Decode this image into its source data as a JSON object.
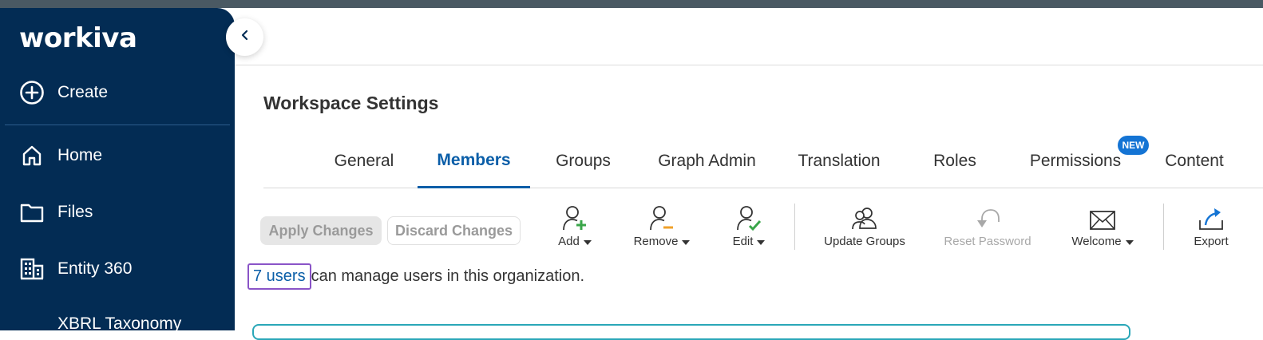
{
  "sidebar": {
    "logo": "workiva",
    "create": {
      "label": "Create",
      "icon": "plus-circle-icon"
    },
    "items": [
      {
        "label": "Home",
        "icon": "home-icon"
      },
      {
        "label": "Files",
        "icon": "folder-icon"
      },
      {
        "label": "Entity 360",
        "icon": "building-icon"
      },
      {
        "label": "XBRL Taxonomy",
        "icon": "taxonomy-icon"
      }
    ]
  },
  "page": {
    "title": "Workspace Settings"
  },
  "tabs": [
    {
      "label": "General"
    },
    {
      "label": "Members",
      "active": true
    },
    {
      "label": "Groups"
    },
    {
      "label": "Graph Admin"
    },
    {
      "label": "Translation"
    },
    {
      "label": "Roles"
    },
    {
      "label": "Permissions",
      "badge": "NEW"
    },
    {
      "label": "Content"
    }
  ],
  "actions": {
    "apply": "Apply Changes",
    "discard": "Discard Changes"
  },
  "toolbar": [
    {
      "label": "Add",
      "icon": "add-user-icon",
      "dropdown": true
    },
    {
      "label": "Remove",
      "icon": "remove-user-icon",
      "dropdown": true
    },
    {
      "label": "Edit",
      "icon": "edit-user-icon",
      "dropdown": true
    },
    {
      "label": "Update Groups",
      "icon": "users-group-icon",
      "dropdown": false
    },
    {
      "label": "Reset Password",
      "icon": "reset-icon",
      "dropdown": false,
      "disabled": true
    },
    {
      "label": "Welcome",
      "icon": "envelope-icon",
      "dropdown": true
    },
    {
      "label": "Export",
      "icon": "export-icon",
      "dropdown": false
    }
  ],
  "info": {
    "link": "7 users",
    "text": "can manage users in this organization."
  },
  "colors": {
    "sidebar": "#032c54",
    "accent": "#0a5ea8",
    "badge": "#1474d4",
    "add_green": "#3aa64a",
    "remove_orange": "#f0a12a"
  }
}
